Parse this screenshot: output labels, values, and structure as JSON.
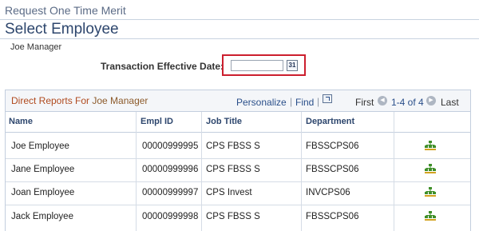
{
  "page": {
    "pagelet_title": "Request One Time Merit",
    "title": "Select Employee",
    "manager_name": "Joe Manager"
  },
  "transaction": {
    "label": "Transaction Effective Date:",
    "value": "",
    "calendar_icon_text": "31"
  },
  "grid": {
    "title_prefix": "Direct Reports For",
    "title_manager": "Joe Manager",
    "personalize_label": "Personalize",
    "separator": "|",
    "find_label": "Find",
    "first_label": "First",
    "range_label": "1-4 of 4",
    "last_label": "Last",
    "columns": [
      "Name",
      "Empl ID",
      "Job Title",
      "Department"
    ],
    "rows": [
      {
        "name": "Joe Employee",
        "empl_id": "00000999995",
        "job_title": "CPS FBSS S",
        "department": "FBSSCPS06"
      },
      {
        "name": "Jane Employee",
        "empl_id": "00000999996",
        "job_title": "CPS FBSS S",
        "department": "FBSSCPS06"
      },
      {
        "name": "Joan Employee",
        "empl_id": "00000999997",
        "job_title": "CPS Invest",
        "department": "INVCPS06"
      },
      {
        "name": "Jack Employee",
        "empl_id": "00000999998",
        "job_title": "CPS FBSS S",
        "department": "FBSSCPS06"
      }
    ]
  },
  "icons": {
    "org_chart": "org-chart-icon",
    "calendar": "calendar-icon",
    "view_all": "view-all-icon",
    "prev": "previous-arrow-icon",
    "next": "next-arrow-icon"
  },
  "colors": {
    "highlight_border": "#cc1f2e",
    "grid_title": "#b04a1e",
    "link": "#2a4f8a",
    "org_icon": "#3f8f2a"
  }
}
